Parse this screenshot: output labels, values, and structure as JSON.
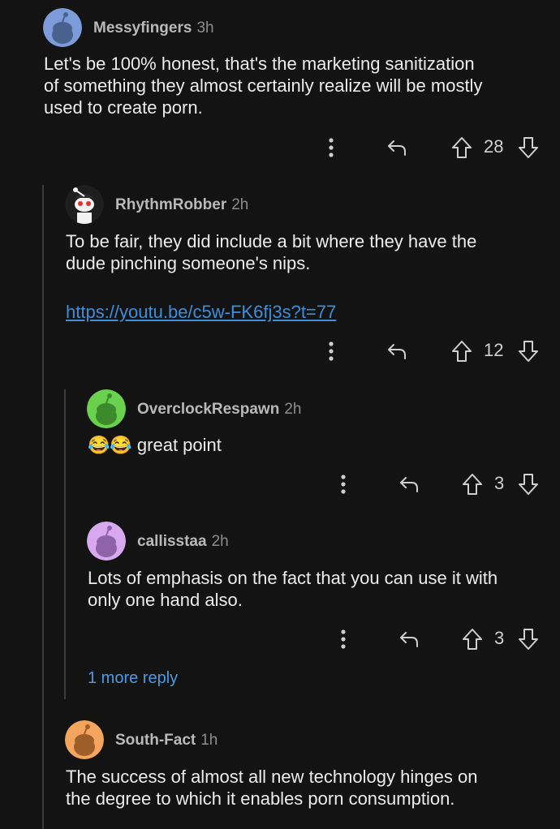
{
  "comments": [
    {
      "user": "Messyfingers",
      "time": "3h",
      "avatar_color": "#7d9bd9",
      "lines": [
        "Let's be 100% honest, that's the marketing sanitization",
        "of something they almost certainly realize will be mostly",
        "used to create porn."
      ],
      "score": "28"
    },
    {
      "user": "RhythmRobber",
      "time": "2h",
      "avatar_color": "#1e1e1e",
      "lines": [
        "To be fair, they did include a bit where they have the",
        "dude pinching someone's nips."
      ],
      "link": "https://youtu.be/c5w-FK6fj3s?t=77",
      "score": "12"
    },
    {
      "user": "OverclockRespawn",
      "time": "2h",
      "avatar_color": "#6ad14e",
      "emoji": "😂😂",
      "text": "great point",
      "score": "3"
    },
    {
      "user": "callisstaa",
      "time": "2h",
      "avatar_color": "#d8a9ef",
      "lines": [
        "Lots of emphasis on the fact that you can use it with",
        "only one hand also."
      ],
      "score": "3"
    },
    {
      "user": "South-Fact",
      "time": "1h",
      "avatar_color": "#f5a45e",
      "lines": [
        "The success of almost all new technology hinges on",
        "the degree to which it enables porn consumption."
      ]
    }
  ],
  "more_replies": "1 more reply",
  "icons": {
    "more": "vertical-dots-icon",
    "reply": "reply-arrow-icon",
    "upvote": "upvote-arrow-icon",
    "downvote": "downvote-arrow-icon"
  },
  "colors": {
    "background": "#131313",
    "link": "#3d8fd9",
    "more_reply": "#4a9be6"
  }
}
